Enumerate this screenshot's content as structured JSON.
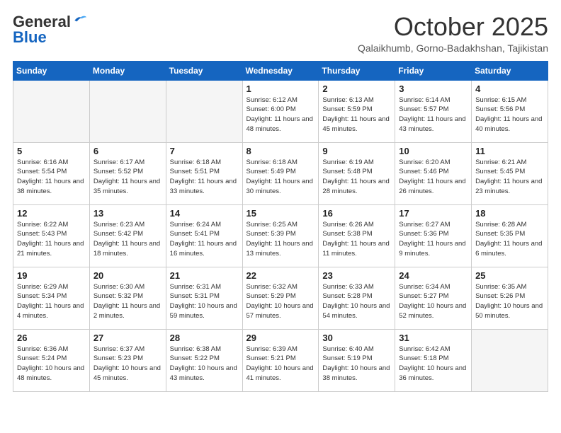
{
  "header": {
    "logo_general": "General",
    "logo_blue": "Blue",
    "month_title": "October 2025",
    "location": "Qalaikhumb, Gorno-Badakhshan, Tajikistan"
  },
  "weekdays": [
    "Sunday",
    "Monday",
    "Tuesday",
    "Wednesday",
    "Thursday",
    "Friday",
    "Saturday"
  ],
  "weeks": [
    [
      {
        "day": "",
        "info": ""
      },
      {
        "day": "",
        "info": ""
      },
      {
        "day": "",
        "info": ""
      },
      {
        "day": "1",
        "info": "Sunrise: 6:12 AM\nSunset: 6:00 PM\nDaylight: 11 hours and 48 minutes."
      },
      {
        "day": "2",
        "info": "Sunrise: 6:13 AM\nSunset: 5:59 PM\nDaylight: 11 hours and 45 minutes."
      },
      {
        "day": "3",
        "info": "Sunrise: 6:14 AM\nSunset: 5:57 PM\nDaylight: 11 hours and 43 minutes."
      },
      {
        "day": "4",
        "info": "Sunrise: 6:15 AM\nSunset: 5:56 PM\nDaylight: 11 hours and 40 minutes."
      }
    ],
    [
      {
        "day": "5",
        "info": "Sunrise: 6:16 AM\nSunset: 5:54 PM\nDaylight: 11 hours and 38 minutes."
      },
      {
        "day": "6",
        "info": "Sunrise: 6:17 AM\nSunset: 5:52 PM\nDaylight: 11 hours and 35 minutes."
      },
      {
        "day": "7",
        "info": "Sunrise: 6:18 AM\nSunset: 5:51 PM\nDaylight: 11 hours and 33 minutes."
      },
      {
        "day": "8",
        "info": "Sunrise: 6:18 AM\nSunset: 5:49 PM\nDaylight: 11 hours and 30 minutes."
      },
      {
        "day": "9",
        "info": "Sunrise: 6:19 AM\nSunset: 5:48 PM\nDaylight: 11 hours and 28 minutes."
      },
      {
        "day": "10",
        "info": "Sunrise: 6:20 AM\nSunset: 5:46 PM\nDaylight: 11 hours and 26 minutes."
      },
      {
        "day": "11",
        "info": "Sunrise: 6:21 AM\nSunset: 5:45 PM\nDaylight: 11 hours and 23 minutes."
      }
    ],
    [
      {
        "day": "12",
        "info": "Sunrise: 6:22 AM\nSunset: 5:43 PM\nDaylight: 11 hours and 21 minutes."
      },
      {
        "day": "13",
        "info": "Sunrise: 6:23 AM\nSunset: 5:42 PM\nDaylight: 11 hours and 18 minutes."
      },
      {
        "day": "14",
        "info": "Sunrise: 6:24 AM\nSunset: 5:41 PM\nDaylight: 11 hours and 16 minutes."
      },
      {
        "day": "15",
        "info": "Sunrise: 6:25 AM\nSunset: 5:39 PM\nDaylight: 11 hours and 13 minutes."
      },
      {
        "day": "16",
        "info": "Sunrise: 6:26 AM\nSunset: 5:38 PM\nDaylight: 11 hours and 11 minutes."
      },
      {
        "day": "17",
        "info": "Sunrise: 6:27 AM\nSunset: 5:36 PM\nDaylight: 11 hours and 9 minutes."
      },
      {
        "day": "18",
        "info": "Sunrise: 6:28 AM\nSunset: 5:35 PM\nDaylight: 11 hours and 6 minutes."
      }
    ],
    [
      {
        "day": "19",
        "info": "Sunrise: 6:29 AM\nSunset: 5:34 PM\nDaylight: 11 hours and 4 minutes."
      },
      {
        "day": "20",
        "info": "Sunrise: 6:30 AM\nSunset: 5:32 PM\nDaylight: 11 hours and 2 minutes."
      },
      {
        "day": "21",
        "info": "Sunrise: 6:31 AM\nSunset: 5:31 PM\nDaylight: 10 hours and 59 minutes."
      },
      {
        "day": "22",
        "info": "Sunrise: 6:32 AM\nSunset: 5:29 PM\nDaylight: 10 hours and 57 minutes."
      },
      {
        "day": "23",
        "info": "Sunrise: 6:33 AM\nSunset: 5:28 PM\nDaylight: 10 hours and 54 minutes."
      },
      {
        "day": "24",
        "info": "Sunrise: 6:34 AM\nSunset: 5:27 PM\nDaylight: 10 hours and 52 minutes."
      },
      {
        "day": "25",
        "info": "Sunrise: 6:35 AM\nSunset: 5:26 PM\nDaylight: 10 hours and 50 minutes."
      }
    ],
    [
      {
        "day": "26",
        "info": "Sunrise: 6:36 AM\nSunset: 5:24 PM\nDaylight: 10 hours and 48 minutes."
      },
      {
        "day": "27",
        "info": "Sunrise: 6:37 AM\nSunset: 5:23 PM\nDaylight: 10 hours and 45 minutes."
      },
      {
        "day": "28",
        "info": "Sunrise: 6:38 AM\nSunset: 5:22 PM\nDaylight: 10 hours and 43 minutes."
      },
      {
        "day": "29",
        "info": "Sunrise: 6:39 AM\nSunset: 5:21 PM\nDaylight: 10 hours and 41 minutes."
      },
      {
        "day": "30",
        "info": "Sunrise: 6:40 AM\nSunset: 5:19 PM\nDaylight: 10 hours and 38 minutes."
      },
      {
        "day": "31",
        "info": "Sunrise: 6:42 AM\nSunset: 5:18 PM\nDaylight: 10 hours and 36 minutes."
      },
      {
        "day": "",
        "info": ""
      }
    ]
  ]
}
